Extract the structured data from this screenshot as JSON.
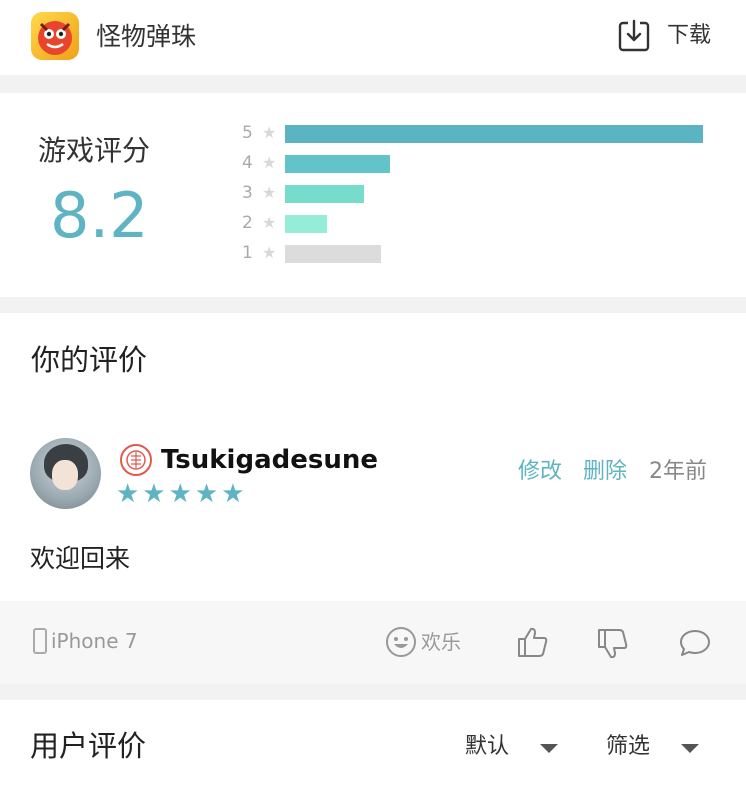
{
  "header": {
    "app_name": "怪物弹珠",
    "download_label": "下载",
    "app_icon": "monster-strike-app-icon",
    "download_icon": "download-icon"
  },
  "rating": {
    "title": "游戏评分",
    "score": "8.2",
    "star_glyph": "★",
    "distribution": [
      {
        "stars": "5",
        "fraction": 1.0,
        "color": "#5ab4c1"
      },
      {
        "stars": "4",
        "fraction": 0.25,
        "color": "#62c3c8"
      },
      {
        "stars": "3",
        "fraction": 0.19,
        "color": "#78dccd"
      },
      {
        "stars": "2",
        "fraction": 0.1,
        "color": "#95ecd9"
      },
      {
        "stars": "1",
        "fraction": 0.23,
        "color": "#dcdcdc"
      }
    ]
  },
  "your_review": {
    "section_title": "你的评价",
    "username": "Tsukigadesune",
    "user_rating": 5,
    "stars_text": "★★★★★",
    "edit_label": "修改",
    "delete_label": "删除",
    "time_ago": "2年前",
    "text": "欢迎回来",
    "device": "iPhone 7",
    "mood": "欢乐"
  },
  "user_reviews": {
    "section_title": "用户评价",
    "sort_label": "默认",
    "filter_label": "筛选"
  },
  "colors": {
    "accent": "#5fb4c4",
    "background": "#f2f2f2"
  }
}
